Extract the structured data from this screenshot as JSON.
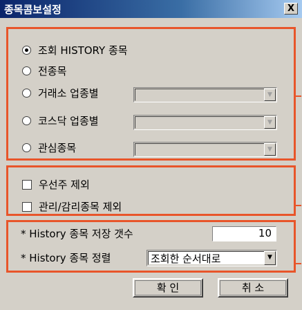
{
  "window": {
    "title": "종목콤보설정",
    "close_label": "X"
  },
  "source_options": [
    {
      "label": "조회 HISTORY 종목",
      "checked": true,
      "has_combo": false
    },
    {
      "label": "전종목",
      "checked": false,
      "has_combo": false
    },
    {
      "label": "거래소 업종별",
      "checked": false,
      "has_combo": true
    },
    {
      "label": "코스닥 업종별",
      "checked": false,
      "has_combo": true
    },
    {
      "label": "관심종목",
      "checked": false,
      "has_combo": true
    }
  ],
  "exclusions": [
    {
      "label": "우선주 제외",
      "checked": false
    },
    {
      "label": "관리/감리종목 제외",
      "checked": false
    }
  ],
  "history": {
    "count_label": "* History 종목 저장 갯수",
    "count_value": "10",
    "sort_label": "* History 종목 정렬",
    "sort_value": "조회한 순서대로"
  },
  "buttons": {
    "ok": "확 인",
    "cancel": "취 소"
  },
  "colors": {
    "highlight": "#e8552a",
    "titlebar": "#0a246a"
  }
}
